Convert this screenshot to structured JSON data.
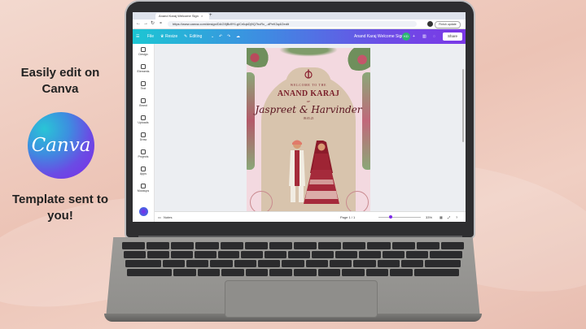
{
  "promo": {
    "line1": "Easily edit on Canva",
    "logo_text": "Canva",
    "line2": "Template sent to you!"
  },
  "browser": {
    "tab_title": "Anand Karaj Welcome Sign",
    "url": "https://www.canva.com/design/DAG9jBd9YLg/Cr6qkDj9Q7hcRc_-dPeK3q4/2edit",
    "finish_update": "Finish update"
  },
  "canva": {
    "file_label": "File",
    "resize_label": "Resize",
    "editing_label": "Editing",
    "design_title": "Anand Karaj Welcome Sign",
    "avatar_initials": "KD",
    "share_label": "Share",
    "sidebar": [
      "Design",
      "Elements",
      "Text",
      "Brand",
      "Uploads",
      "Draw",
      "Projects",
      "Apps",
      "Mockups"
    ],
    "notes_label": "Notes",
    "page_indicator": "Page 1 / 1",
    "zoom": "33%"
  },
  "invitation": {
    "welcome": "WELCOME TO THE",
    "title": "ANAND KARAJ",
    "of": "OF",
    "names": "Jaspreet & Harvinder",
    "date": "09.05.25"
  },
  "colors": {
    "canva_gradient_start": "#1cc6d3",
    "canva_gradient_end": "#7b38e6",
    "invite_text": "#7a1f2a",
    "arch": "#d8c4ad"
  }
}
